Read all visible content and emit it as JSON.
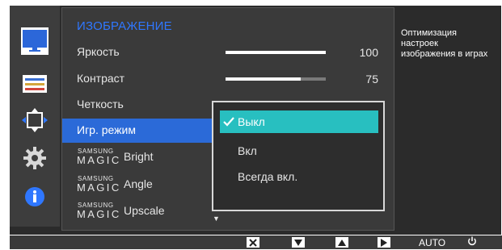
{
  "menu": {
    "title": "ИЗОБРАЖЕНИЕ",
    "brightness": {
      "label": "Яркость",
      "value": "100",
      "level_percent": 100
    },
    "contrast": {
      "label": "Контраст",
      "value": "75",
      "level_percent": 75
    },
    "sharpness": {
      "label": "Четкость"
    },
    "game_mode": {
      "label": "Игр. режим"
    },
    "magic_bright": {
      "brand_top": "SAMSUNG",
      "brand_bottom": "MAGIC",
      "label": "Bright"
    },
    "magic_angle": {
      "brand_top": "SAMSUNG",
      "brand_bottom": "MAGIC",
      "label": "Angle"
    },
    "magic_upscale": {
      "brand_top": "SAMSUNG",
      "brand_bottom": "MAGIC",
      "label": "Upscale"
    },
    "more_arrow": "▼"
  },
  "popup": {
    "options": [
      {
        "label": "Выкл",
        "selected": true
      },
      {
        "label": "Вкл",
        "selected": false
      },
      {
        "label": "Всегда вкл.",
        "selected": false
      }
    ],
    "check_symbol": "✓"
  },
  "hint": {
    "line1": "Оптимизация",
    "line2": "настроек",
    "line3": "изображения в играх"
  },
  "bottom": {
    "auto_label": "AUTO"
  },
  "colors": {
    "accent_blue": "#2b6ad8",
    "title_blue": "#2f77ff",
    "popup_highlight": "#28bfc0"
  },
  "icons": [
    "monitor-icon",
    "settings-list-icon",
    "resize-arrows-icon",
    "gear-icon",
    "info-icon",
    "close-icon",
    "down-icon",
    "up-icon",
    "enter-icon",
    "power-icon"
  ]
}
